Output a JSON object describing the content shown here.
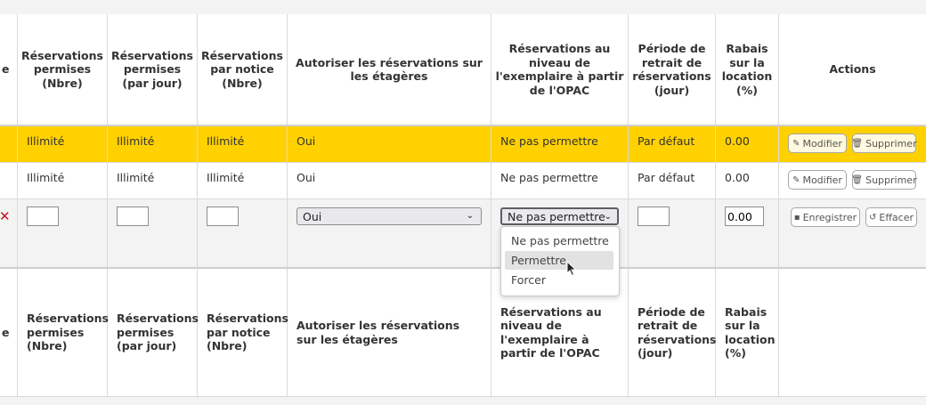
{
  "header": {
    "cut_col": "e",
    "cols": [
      "Réservations permises (Nbre)",
      "Réservations permises (par jour)",
      "Réservations par notice (Nbre)",
      "Autoriser les réservations sur les étagères",
      "Réservations au niveau de l'exemplaire à partir de l'OPAC",
      "Période de retrait de réservations (jour)",
      "Rabais sur la location (%)",
      "Actions"
    ]
  },
  "rows": [
    {
      "highlighted": true,
      "cells": [
        "Illimité",
        "Illimité",
        "Illimité",
        "Oui",
        "Ne pas permettre",
        "Par défaut",
        "0.00"
      ],
      "edit_label": "Modifier",
      "delete_label": "Supprimer"
    },
    {
      "highlighted": false,
      "cells": [
        "Illimité",
        "Illimité",
        "Illimité",
        "Oui",
        "Ne pas permettre",
        "Par défaut",
        "0.00"
      ],
      "edit_label": "Modifier",
      "delete_label": "Supprimer"
    }
  ],
  "edit_row": {
    "cut_mark": "✕",
    "holds_allowed": "",
    "holds_per_day": "",
    "holds_per_record": "",
    "onshelf_select": "Oui",
    "opac_item_select": "Ne pas permettre",
    "pickup_period": "",
    "rental_discount": "0.00",
    "save_label": "Enregistrer",
    "clear_label": "Effacer"
  },
  "dropdown": {
    "options": [
      "Ne pas permettre",
      "Permettre",
      "Forcer"
    ],
    "hovered_index": 1
  },
  "footer": {
    "cut_col": "e",
    "cols": [
      "Réservations permises (Nbre)",
      "Réservations permises (par jour)",
      "Réservations par notice (Nbre)",
      "Autoriser les réservations sur les étagères",
      "Réservations au niveau de l'exemplaire à partir de l'OPAC",
      "Période de retrait de réservations (jour)",
      "Rabais sur la location (%)"
    ]
  },
  "icons": {
    "edit": "pencil-icon",
    "delete": "trash-icon",
    "save": "floppy-icon",
    "clear": "undo-icon",
    "chevron": "chevron-down-icon",
    "cursor": "mouse-pointer-icon"
  },
  "colors": {
    "highlight_row": "#ffd100",
    "cut_mark": "#c0141a",
    "edit_row_bg": "#f3f3f3"
  }
}
